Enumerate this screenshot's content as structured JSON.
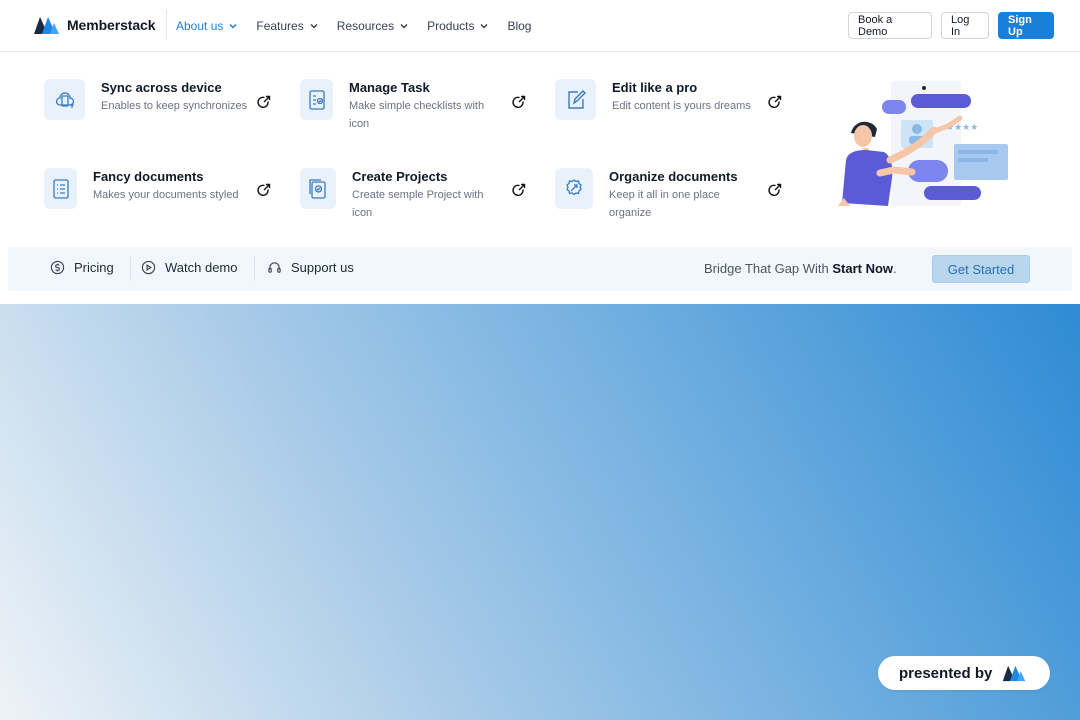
{
  "brand": {
    "name": "Memberstack"
  },
  "nav": {
    "links": [
      {
        "label": "About us",
        "active": true
      },
      {
        "label": "Features"
      },
      {
        "label": "Resources"
      },
      {
        "label": "Products"
      },
      {
        "label": "Blog"
      }
    ],
    "book_demo": "Book a Demo",
    "login": "Log In",
    "signup": "Sign Up"
  },
  "features": [
    {
      "title": "Sync across device",
      "desc": "Enables to keep synchronizes",
      "icon": "sync-device-icon"
    },
    {
      "title": "Manage Task",
      "desc": "Make simple checklists with icon",
      "icon": "checklist-icon"
    },
    {
      "title": "Edit like a pro",
      "desc": "Edit content is yours dreams",
      "icon": "edit-icon"
    },
    {
      "title": "Fancy documents",
      "desc": "Makes your documents styled",
      "icon": "document-icon"
    },
    {
      "title": "Create Projects",
      "desc": "Create semple Project with icon",
      "icon": "project-icon"
    },
    {
      "title": "Organize documents",
      "desc": "Keep it all in one place organize",
      "icon": "organize-icon"
    }
  ],
  "bottom_bar": {
    "pricing": "Pricing",
    "watch_demo": "Watch demo",
    "support": "Support us",
    "tagline_prefix": "Bridge That Gap With ",
    "tagline_bold": "Start Now",
    "tagline_suffix": ".",
    "cta": "Get Started"
  },
  "badge": {
    "label": "presented by"
  },
  "colors": {
    "accent": "#1a7fd8",
    "hero_start": "#eef3f7",
    "hero_end": "#2e8bd4",
    "illus_purple": "#5b5bd6"
  }
}
